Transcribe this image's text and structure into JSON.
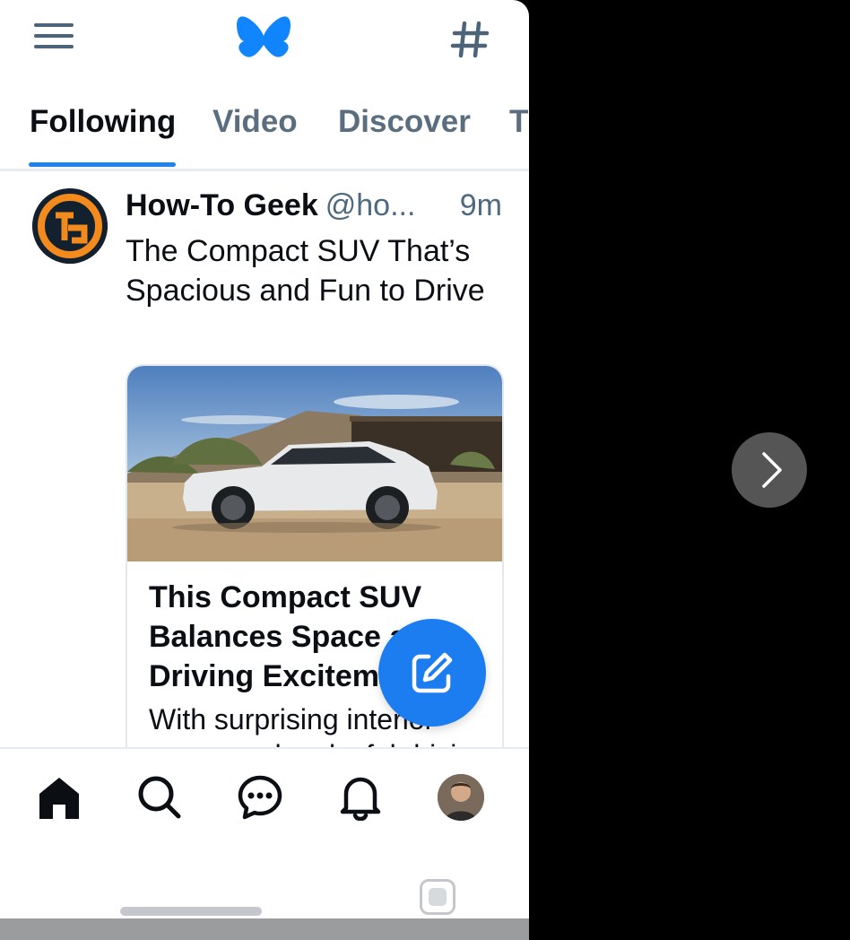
{
  "header": {
    "menu_icon": "hamburger-icon",
    "logo_icon": "butterfly-logo-icon",
    "feeds_icon": "hashtag-icon"
  },
  "tabs": [
    {
      "label": "Following",
      "active": true
    },
    {
      "label": "Video",
      "active": false
    },
    {
      "label": "Discover",
      "active": false
    },
    {
      "label": "T",
      "active": false
    }
  ],
  "post": {
    "author": "How-To Geek",
    "handle": "@ho...",
    "time": "9m",
    "text": "The Compact SUV That’s Spacious and Fun to Drive",
    "card": {
      "title": "This Compact SUV Balances Space and Driving Excitement",
      "description": "With surprising interior space and a playful driving"
    }
  },
  "fab": {
    "icon": "compose-icon"
  },
  "bottom_nav": {
    "items": [
      "home-icon",
      "search-icon",
      "chat-icon",
      "bell-icon",
      "profile-avatar"
    ]
  },
  "overlay": {
    "next_icon": "chevron-right-icon"
  },
  "colors": {
    "accent": "#1f83ee",
    "fab": "#1c7df0",
    "muted": "#4f6a80",
    "text": "#0b0f14"
  }
}
